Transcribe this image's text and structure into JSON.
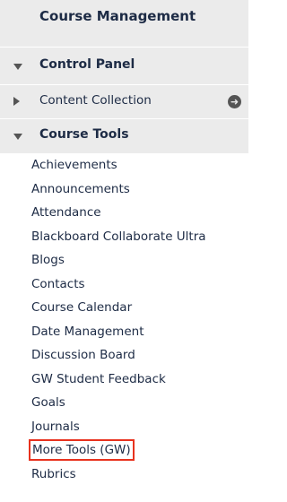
{
  "course_management": {
    "title": "Course Management"
  },
  "control_panel": {
    "label": "Control Panel",
    "expand_icon": "triangle-down"
  },
  "content_collection": {
    "label": "Content Collection",
    "expand_icon": "triangle-right",
    "go_icon": "arrow-circle-right"
  },
  "course_tools": {
    "label": "Course Tools",
    "expand_icon": "triangle-down",
    "items": [
      {
        "label": "Achievements"
      },
      {
        "label": "Announcements"
      },
      {
        "label": "Attendance"
      },
      {
        "label": "Blackboard Collaborate Ultra"
      },
      {
        "label": "Blogs"
      },
      {
        "label": "Contacts"
      },
      {
        "label": "Course Calendar"
      },
      {
        "label": "Date Management"
      },
      {
        "label": "Discussion Board"
      },
      {
        "label": "GW Student Feedback"
      },
      {
        "label": "Goals"
      },
      {
        "label": "Journals"
      },
      {
        "label": "More Tools (GW)",
        "highlighted": true
      },
      {
        "label": "Rubrics"
      }
    ]
  },
  "colors": {
    "panel_bg": "#ebebeb",
    "text": "#1d2b45",
    "highlight_border": "#e8321e",
    "icon": "#555555"
  }
}
